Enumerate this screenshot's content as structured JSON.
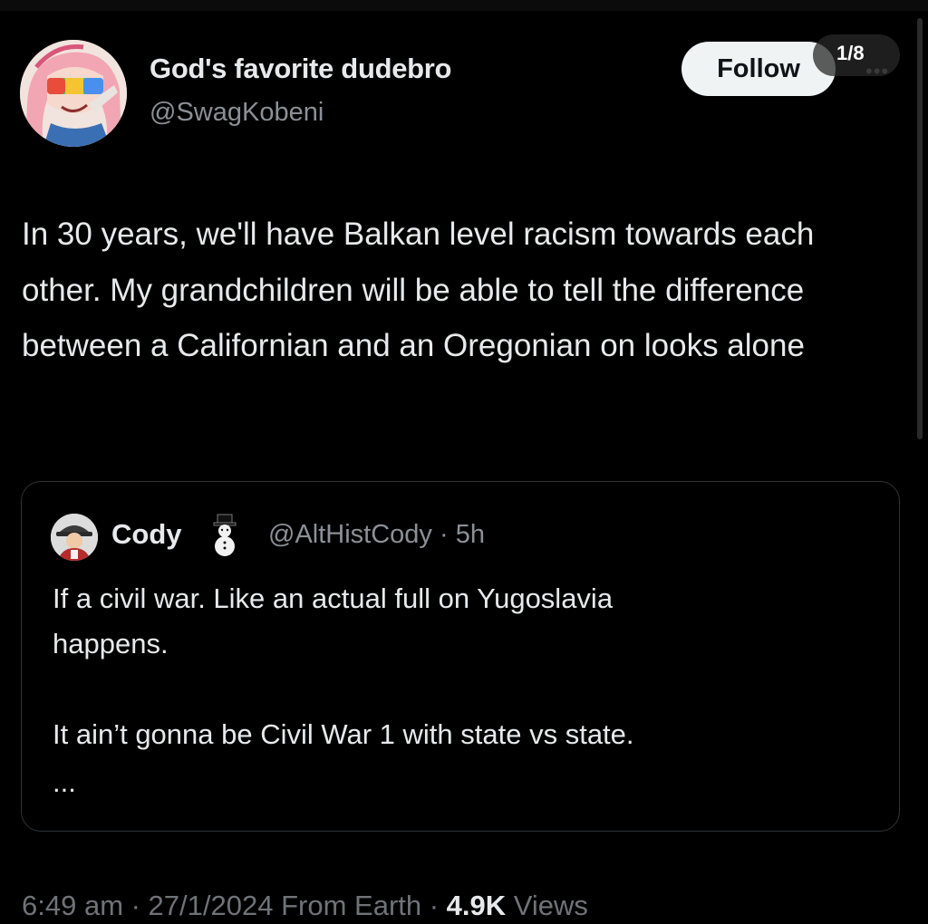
{
  "author": {
    "display_name": "God's favorite dudebro",
    "handle": "@SwagKobeni"
  },
  "follow_button": {
    "label": "Follow"
  },
  "page_indicator": {
    "label": "1/8"
  },
  "tweet": {
    "text": "In 30 years, we'll have Balkan level racism towards each other. My grandchildren will be able to tell the difference between a Californian and an Oregonian on looks alone"
  },
  "quoted_tweet": {
    "name": "Cody",
    "badge_icon": "snowman-icon",
    "handle_time": "@AltHistCody · 5h",
    "text": "If a civil war. Like an actual full on Yugoslavia\nhappens.\n\nIt ain’t gonna be Civil War 1 with state vs state.",
    "ellipsis": "..."
  },
  "meta": {
    "time_date": "6:49 am · 27/1/2024 From Earth · ",
    "views_count": "4.9K",
    "views_label": " Views"
  }
}
